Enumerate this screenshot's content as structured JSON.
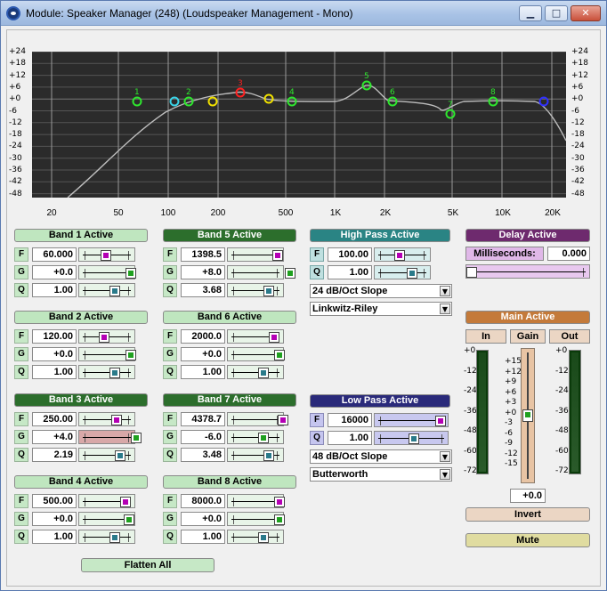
{
  "window": {
    "title": "Module: Speaker Manager (248) (Loudspeaker Management - Mono)"
  },
  "graph": {
    "y_labels": [
      "+24",
      "+18",
      "+12",
      "+6",
      "+0",
      "-6",
      "-12",
      "-18",
      "-24",
      "-30",
      "-36",
      "-42",
      "-48"
    ],
    "x_labels": [
      "20",
      "50",
      "100",
      "200",
      "500",
      "1K",
      "2K",
      "5K",
      "10K",
      "20K"
    ],
    "nodes": [
      "1",
      "2",
      "3",
      "4",
      "5",
      "6",
      "7",
      "8"
    ]
  },
  "bands": [
    {
      "label": "Band 1 Active",
      "f": "60.000",
      "g": "+0.0",
      "q": "1.00",
      "style": "light"
    },
    {
      "label": "Band 2 Active",
      "f": "120.00",
      "g": "+0.0",
      "q": "1.00",
      "style": "light"
    },
    {
      "label": "Band 3 Active",
      "f": "250.00",
      "g": "+4.0",
      "q": "2.19",
      "style": "dark"
    },
    {
      "label": "Band 4 Active",
      "f": "500.00",
      "g": "+0.0",
      "q": "1.00",
      "style": "light"
    },
    {
      "label": "Band 5 Active",
      "f": "1398.5",
      "g": "+8.0",
      "q": "3.68",
      "style": "dark"
    },
    {
      "label": "Band 6 Active",
      "f": "2000.0",
      "g": "+0.0",
      "q": "1.00",
      "style": "light"
    },
    {
      "label": "Band 7 Active",
      "f": "4378.7",
      "g": "-6.0",
      "q": "3.48",
      "style": "dark"
    },
    {
      "label": "Band 8 Active",
      "f": "8000.0",
      "g": "+0.0",
      "q": "1.00",
      "style": "light"
    }
  ],
  "row_labels": {
    "f": "F",
    "g": "G",
    "q": "Q"
  },
  "high_pass": {
    "label": "High Pass Active",
    "f": "100.00",
    "q": "1.00",
    "slope": "24 dB/Oct Slope",
    "type": "Linkwitz-Riley"
  },
  "low_pass": {
    "label": "Low Pass Active",
    "f": "16000",
    "q": "1.00",
    "slope": "48 dB/Oct Slope",
    "type": "Butterworth"
  },
  "delay": {
    "label": "Delay Active",
    "ms_label": "Milliseconds:",
    "ms_value": "0.000"
  },
  "main": {
    "label": "Main Active",
    "in_label": "In",
    "gain_label": "Gain",
    "out_label": "Out",
    "meter_scale": [
      "+0",
      "-12",
      "-24",
      "-36",
      "-48",
      "-60",
      "-72"
    ],
    "gain_scale": [
      "+15",
      "+12",
      "+9",
      "+6",
      "+3",
      "+0",
      "-3",
      "-6",
      "-9",
      "-12",
      "-15"
    ],
    "gain_value": "+0.0",
    "invert_label": "Invert",
    "mute_label": "Mute"
  },
  "flatten_label": "Flatten All",
  "colors": {
    "band_header_light": "#bfe6bf",
    "band_header_dark": "#2c6e2c",
    "high_pass": "#2a8484",
    "low_pass": "#2a2a7a",
    "delay": "#6e2a6e",
    "main": "#c47a3a",
    "graph_bg": "#2b2b2b"
  }
}
